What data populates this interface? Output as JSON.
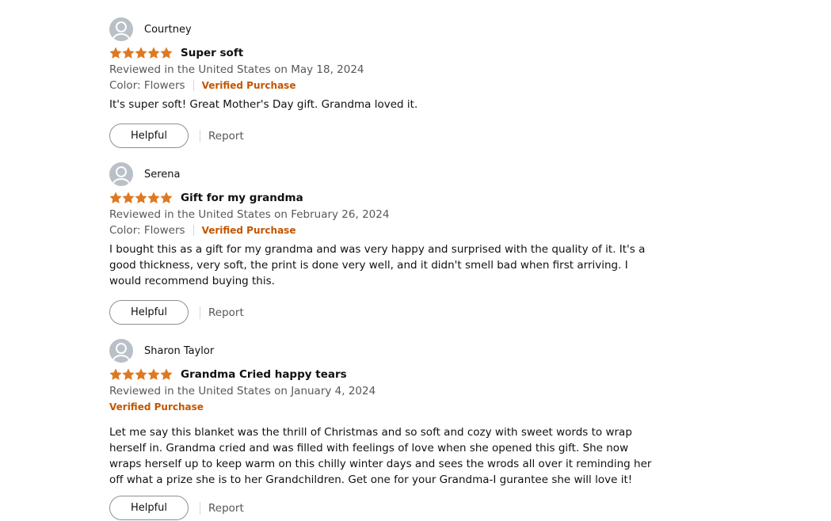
{
  "reviews": [
    {
      "reviewer": "Courtney",
      "rating": 5,
      "title": "Super soft",
      "date_line": "Reviewed in the United States on May 18, 2024",
      "format": "Color: Flowers",
      "verified": "Verified Purchase",
      "body": "It's super soft! Great Mother's Day gift. Grandma loved it.",
      "helpful_label": "Helpful",
      "report_label": "Report"
    },
    {
      "reviewer": "Serena",
      "rating": 5,
      "title": "Gift for my grandma",
      "date_line": "Reviewed in the United States on February 26, 2024",
      "format": "Color: Flowers",
      "verified": "Verified Purchase",
      "body": "I bought this as a gift for my grandma and was very happy and surprised with the quality of it. It's a good thickness, very soft, the print is done very well, and it didn't smell bad when first arriving. I would recommend buying this.",
      "helpful_label": "Helpful",
      "report_label": "Report"
    },
    {
      "reviewer": "Sharon Taylor",
      "rating": 5,
      "title": "Grandma Cried happy tears",
      "date_line": "Reviewed in the United States on January 4, 2024",
      "verified": "Verified Purchase",
      "body": "Let me say this blanket was the thrill of Christmas and so soft and cozy with sweet words to wrap herself in. Grandma cried and was filled with feelings of love when she opened this gift. She now wraps herself up to keep warm on this chilly winter days and sees the wrods all over it reminding her off what a prize she is to her Grandchildren. Get one for your Grandma-I gurantee she will love it!",
      "helpful_label": "Helpful",
      "report_label": "Report"
    }
  ],
  "colors": {
    "star": "#de7921",
    "verified": "#c45500",
    "meta": "#565959"
  }
}
